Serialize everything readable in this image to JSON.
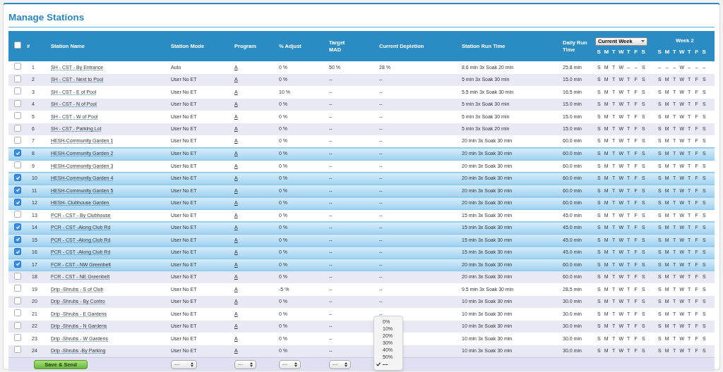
{
  "title": "Manage Stations",
  "header": {
    "select_all": {
      "checked": false
    },
    "columns": [
      "#",
      "Station Name",
      "Station Mode",
      "Program",
      "% Adjust",
      "Target MAD",
      "Current Depletion",
      "Station Run Time",
      "Daily Run Time"
    ],
    "week_select": "Current Week",
    "week2_label": "Week 2",
    "week_days": [
      "S M T W T F S",
      "S M T W T F S"
    ]
  },
  "rows": [
    {
      "checked": false,
      "num": "1",
      "name": "SH - CST - By Entrance",
      "mode": "Auto",
      "program": "A",
      "adjust": "0 %",
      "mad": "50 %",
      "depletion": "28 %",
      "run_time": "8.6 min 3x Soak 20 min",
      "daily": "25.8 min",
      "week1": "S M T W – – S",
      "week2": "– – – W – – –"
    },
    {
      "checked": false,
      "num": "2",
      "name": "SH - CST - Next to Pool",
      "mode": "User No ET",
      "program": "A",
      "adjust": "0 %",
      "mad": "--",
      "depletion": "--",
      "run_time": "5 min 3x Soak 30 min",
      "daily": "15.0 min",
      "week1": "S M T W T F S",
      "week2": "S M T W T F S"
    },
    {
      "checked": false,
      "num": "3",
      "name": "SH - CST - E of Pool",
      "mode": "User No ET",
      "program": "A",
      "adjust": "10 %",
      "mad": "--",
      "depletion": "--",
      "run_time": "5.5 min 3x Soak 30 min",
      "daily": "16.5 min",
      "week1": "S M T W T F S",
      "week2": "S M T W T F S"
    },
    {
      "checked": false,
      "num": "4",
      "name": "SH - CST - N of Pool",
      "mode": "User No ET",
      "program": "A",
      "adjust": "0 %",
      "mad": "--",
      "depletion": "--",
      "run_time": "5 min 3x Soak 30 min",
      "daily": "15.0 min",
      "week1": "S M T W T F S",
      "week2": "S M T W T F S"
    },
    {
      "checked": false,
      "num": "5",
      "name": "SH - CST - W of Pool",
      "mode": "User No ET",
      "program": "A",
      "adjust": "0 %",
      "mad": "--",
      "depletion": "--",
      "run_time": "5 min 3x Soak 30 min",
      "daily": "15.0 min",
      "week1": "S M T W T F S",
      "week2": "S M T W T F S"
    },
    {
      "checked": false,
      "num": "6",
      "name": "SH - CST - Parking Lot",
      "mode": "User No ET",
      "program": "A",
      "adjust": "0 %",
      "mad": "--",
      "depletion": "--",
      "run_time": "5 min 3x Soak 20 min",
      "daily": "15.0 min",
      "week1": "S M T W T F S",
      "week2": "S M T W T F S"
    },
    {
      "checked": false,
      "num": "7",
      "name": "HESH-Community Garden 1",
      "mode": "User No ET",
      "program": "A",
      "adjust": "0 %",
      "mad": "--",
      "depletion": "--",
      "run_time": "20 min 3x Soak 30 min",
      "daily": "60.0 min",
      "week1": "S M T W T F S",
      "week2": "S M T W T F S"
    },
    {
      "checked": true,
      "num": "8",
      "name": "HESH-Community Garden 2",
      "mode": "User No ET",
      "program": "A",
      "adjust": "0 %",
      "mad": "--",
      "depletion": "--",
      "run_time": "20 min 3x Soak 30 min",
      "daily": "60.0 min",
      "week1": "S M T W T F S",
      "week2": "S M T W T F S"
    },
    {
      "checked": false,
      "num": "9",
      "name": "HESH-Community Garden 3",
      "mode": "User No ET",
      "program": "A",
      "adjust": "0 %",
      "mad": "--",
      "depletion": "--",
      "run_time": "20 min 3x Soak 30 min",
      "daily": "60.0 min",
      "week1": "S M T W T F S",
      "week2": "S M T W T F S"
    },
    {
      "checked": true,
      "num": "10",
      "name": "HESH-Community Garden 4",
      "mode": "User No ET",
      "program": "A",
      "adjust": "0 %",
      "mad": "--",
      "depletion": "--",
      "run_time": "20 min 3x Soak 30 min",
      "daily": "60.0 min",
      "week1": "S M T W T F S",
      "week2": "S M T W T F S"
    },
    {
      "checked": true,
      "num": "11",
      "name": "HESH-Community Garden 5",
      "mode": "User No ET",
      "program": "A",
      "adjust": "0 %",
      "mad": "--",
      "depletion": "--",
      "run_time": "20 min 3x Soak 30 min",
      "daily": "60.0 min",
      "week1": "S M T W T F S",
      "week2": "S M T W T F S"
    },
    {
      "checked": true,
      "num": "12",
      "name": "HESH- Clubhouse Garden",
      "mode": "User No ET",
      "program": "A",
      "adjust": "0 %",
      "mad": "--",
      "depletion": "--",
      "run_time": "20 min 3x Soak 30 min",
      "daily": "60.0 min",
      "week1": "S M T W T F S",
      "week2": "S M T W T F S"
    },
    {
      "checked": false,
      "num": "13",
      "name": "PCR - CST - By Clubhouse",
      "mode": "User No ET",
      "program": "A",
      "adjust": "0 %",
      "mad": "--",
      "depletion": "--",
      "run_time": "15 min 3x Soak 30 min",
      "daily": "45.0 min",
      "week1": "S M T W T F S",
      "week2": "S M T W T F S"
    },
    {
      "checked": true,
      "num": "14",
      "name": "PCR - CST -Along Club Rd",
      "mode": "User No ET",
      "program": "A",
      "adjust": "0 %",
      "mad": "--",
      "depletion": "--",
      "run_time": "15 min 3x Soak 30 min",
      "daily": "45.0 min",
      "week1": "S M T W T F S",
      "week2": "S M T W T F S"
    },
    {
      "checked": true,
      "num": "15",
      "name": "PCR - CST -Along Club Rd",
      "mode": "User No ET",
      "program": "A",
      "adjust": "0 %",
      "mad": "--",
      "depletion": "--",
      "run_time": "15 min 3x Soak 30 min",
      "daily": "45.0 min",
      "week1": "S M T W T F S",
      "week2": "S M T W T F S"
    },
    {
      "checked": true,
      "num": "16",
      "name": "PCR - CST -Along Club Rd",
      "mode": "User No ET",
      "program": "A",
      "adjust": "0 %",
      "mad": "--",
      "depletion": "--",
      "run_time": "15 min 3x Soak 30 min",
      "daily": "45.0 min",
      "week1": "S M T W T F S",
      "week2": "S M T W T F S"
    },
    {
      "checked": true,
      "num": "17",
      "name": "FCR - CST - NW Greenbelt",
      "mode": "User No ET",
      "program": "A",
      "adjust": "0 %",
      "mad": "--",
      "depletion": "--",
      "run_time": "20 min 3x Soak 30 min",
      "daily": "60.0 min",
      "week1": "S M T W T F S",
      "week2": "S M T W T F S"
    },
    {
      "checked": false,
      "num": "18",
      "name": "FCR - CST - NE Greenbelt",
      "mode": "User No ET",
      "program": "A",
      "adjust": "0 %",
      "mad": "--",
      "depletion": "--",
      "run_time": "20 min 3x Soak 30 min",
      "daily": "60.0 min",
      "week1": "S M T W T F S",
      "week2": "S M T W T F S"
    },
    {
      "checked": false,
      "num": "19",
      "name": "Drip -Shrubs - S of Club",
      "mode": "User No ET",
      "program": "A",
      "adjust": "-5 %",
      "mad": "--",
      "depletion": "--",
      "run_time": "9.5 min 3x Soak 30 min",
      "daily": "28.5 min",
      "week1": "S M T W T F S",
      "week2": "S M T W T F S"
    },
    {
      "checked": false,
      "num": "20",
      "name": "Drip -Shrubs - By Contro",
      "mode": "User No ET",
      "program": "A",
      "adjust": "0 %",
      "mad": "--",
      "depletion": "--",
      "run_time": "10 min 3x Soak 30 min",
      "daily": "30.0 min",
      "week1": "S M T W T F S",
      "week2": "S M T W T F S"
    },
    {
      "checked": false,
      "num": "21",
      "name": "Drip -Shrubs - E Gardens",
      "mode": "User No ET",
      "program": "A",
      "adjust": "0 %",
      "mad": "--",
      "depletion": "--",
      "run_time": "10 min 3x Soak 30 min",
      "daily": "30.0 min",
      "week1": "S M T W T F S",
      "week2": "S M T W T F S"
    },
    {
      "checked": false,
      "num": "22",
      "name": "Drip -Shrubs - N Gardens",
      "mode": "User No ET",
      "program": "A",
      "adjust": "0 %",
      "mad": "--",
      "run_time": "10 min 3x Soak 30 min",
      "daily": "30.0 min",
      "week1": "S M T W T F S",
      "week2": "S M T W T F S"
    },
    {
      "checked": false,
      "num": "23",
      "name": "Drip -Shrubs - W Gardens",
      "mode": "User No ET",
      "program": "A",
      "adjust": "0 %",
      "mad": "--",
      "run_time": "10 min 3x Soak 30 min",
      "daily": "30.0 min",
      "week1": "S M T W T F S",
      "week2": "S M T W T F S"
    },
    {
      "checked": false,
      "num": "24",
      "name": "Drip -Shrubs -By Parking",
      "mode": "User No ET",
      "program": "A",
      "adjust": "0 %",
      "mad": "--",
      "run_time": "10 min 3x Soak 30 min",
      "daily": "30.0 min",
      "week1": "S M T W T F S",
      "week2": "S M T W T F S"
    }
  ],
  "footer": {
    "button": "Save & Send",
    "selects": [
      "---",
      "---",
      "---",
      "---"
    ],
    "menu": [
      {
        "label": "0%",
        "selected": false
      },
      {
        "label": "10%",
        "selected": false
      },
      {
        "label": "20%",
        "selected": false
      },
      {
        "label": "30%",
        "selected": false
      },
      {
        "label": "40%",
        "selected": false
      },
      {
        "label": "50%",
        "selected": false
      },
      {
        "label": "---",
        "selected": true
      }
    ]
  }
}
